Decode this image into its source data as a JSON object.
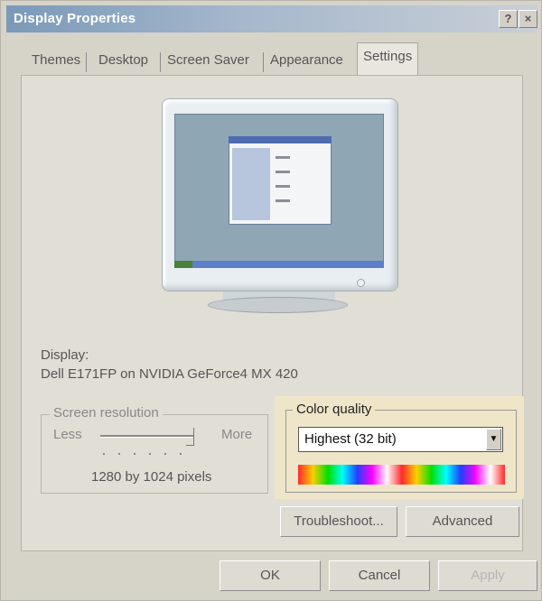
{
  "window": {
    "title": "Display Properties",
    "help_label": "?",
    "close_label": "×"
  },
  "tabs": [
    {
      "label": "Themes"
    },
    {
      "label": "Desktop"
    },
    {
      "label": "Screen Saver"
    },
    {
      "label": "Appearance"
    },
    {
      "label": "Settings",
      "active": true
    }
  ],
  "display": {
    "label": "Display:",
    "device": "Dell E171FP on NVIDIA GeForce4 MX 420"
  },
  "screen_resolution": {
    "caption": "Screen resolution",
    "less_label": "Less",
    "more_label": "More",
    "value_text": "1280 by 1024 pixels",
    "slider_level": 1.0
  },
  "color_quality": {
    "caption": "Color quality",
    "selected": "Highest (32 bit)",
    "spectrum_colors": [
      "#ff2a2a",
      "#ffd000",
      "#00e000",
      "#00ffff",
      "#2040ff",
      "#ff00ff",
      "#ffffff"
    ]
  },
  "buttons": {
    "troubleshoot": "Troubleshoot...",
    "advanced": "Advanced",
    "ok": "OK",
    "cancel": "Cancel",
    "apply": "Apply"
  },
  "colors": {
    "title_gradient_start": "#7b99b8",
    "panel_background": "#e1ded5",
    "highlight_box": "#efe5c8"
  }
}
